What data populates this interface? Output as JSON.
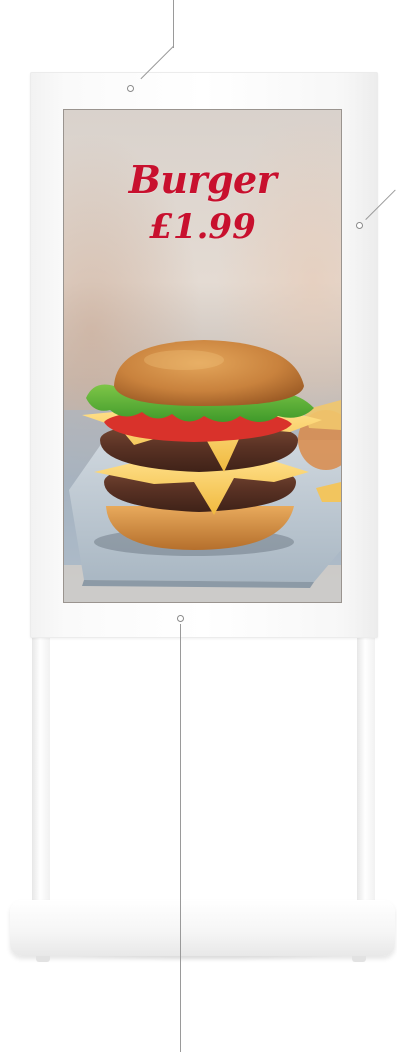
{
  "advertisement": {
    "product_name": "Burger",
    "price": "£1.99"
  },
  "colors": {
    "text_accent": "#c8102e",
    "kiosk_body": "#ffffff",
    "screen_bezel": "#9a948f"
  },
  "icons": {
    "callout_marker": "circle-dot-icon"
  }
}
